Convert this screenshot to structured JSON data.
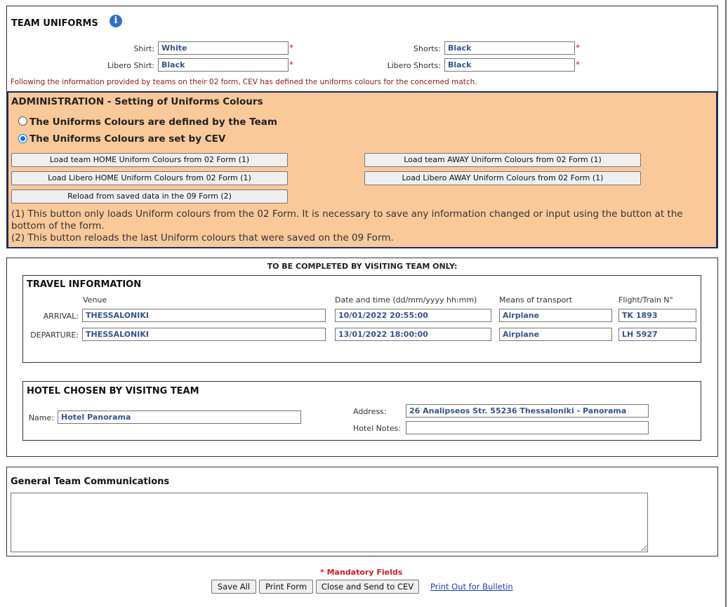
{
  "uniforms": {
    "title": "TEAM UNIFORMS",
    "shirt_label": "Shirt:",
    "shirt_value": "White",
    "shorts_label": "Shorts:",
    "shorts_value": "Black",
    "libero_shirt_label": "Libero Shirt:",
    "libero_shirt_value": "Black",
    "libero_shorts_label": "Libero Shorts:",
    "libero_shorts_value": "Black",
    "required_mark": "*",
    "info_text": "Following the information provided by teams on their 02 form, CEV has defined the uniforms colours for the concerned match."
  },
  "admin": {
    "title": "ADMINISTRATION - Setting of Uniforms Colours",
    "radio_team": "The Uniforms Colours are defined by the Team",
    "radio_cev": "The Uniforms Colours are set by CEV",
    "selected": "cev",
    "btn_home": "Load team HOME Uniform Colours from 02 Form (1)",
    "btn_away": "Load team AWAY Uniform Colours from 02 Form (1)",
    "btn_libero_home": "Load Libero HOME Uniform Colours from 02 Form (1)",
    "btn_libero_away": "Load Libero AWAY Uniform Colours from 02 Form (1)",
    "btn_reload": "Reload from saved data in the 09 Form (2)",
    "note1": "(1) This button only loads Uniform colours from the 02 Form. It is necessary to save any information changed or input using the button at the bottom of the form.",
    "note2": "(2) This button reloads the last Uniform colours that were saved on the 09 Form."
  },
  "visiting": {
    "heading": "TO BE COMPLETED BY VISITING TEAM ONLY:",
    "travel": {
      "title": "TRAVEL INFORMATION",
      "col_venue": "Venue",
      "col_date": "Date and time (dd/mm/yyyy hh:mm)",
      "col_means": "Means of transport",
      "col_flight": "Flight/Train N°",
      "arrival_label": "ARRIVAL:",
      "arrival": {
        "venue": "THESSALONIKI",
        "date": "10/01/2022 20:55:00",
        "means": "Airplane",
        "flight": "TK 1893"
      },
      "departure_label": "DEPARTURE:",
      "departure": {
        "venue": "THESSALONIKI",
        "date": "13/01/2022 18:00:00",
        "means": "Airplane",
        "flight": "LH 5927"
      }
    },
    "hotel": {
      "title": "HOTEL CHOSEN BY VISITNG TEAM",
      "name_label": "Name:",
      "name_value": "Hotel Panorama",
      "address_label": "Address:",
      "address_value": "26 Analipseos Str. 55236 Thessaloniki - Panorama",
      "notes_label": "Hotel Notes:",
      "notes_value": ""
    }
  },
  "communications": {
    "title": "General Team Communications",
    "value": ""
  },
  "footer": {
    "mandatory": "* Mandatory Fields",
    "save_all": "Save All",
    "print_form": "Print Form",
    "close_send": "Close and Send to CEV",
    "print_bulletin": "Print Out for Bulletin"
  },
  "colors": {
    "admin_bg": "#fac999",
    "admin_border": "#1b2a6b",
    "input_text": "#35548c",
    "required": "#d41c1c",
    "link": "#1a3fc2"
  }
}
